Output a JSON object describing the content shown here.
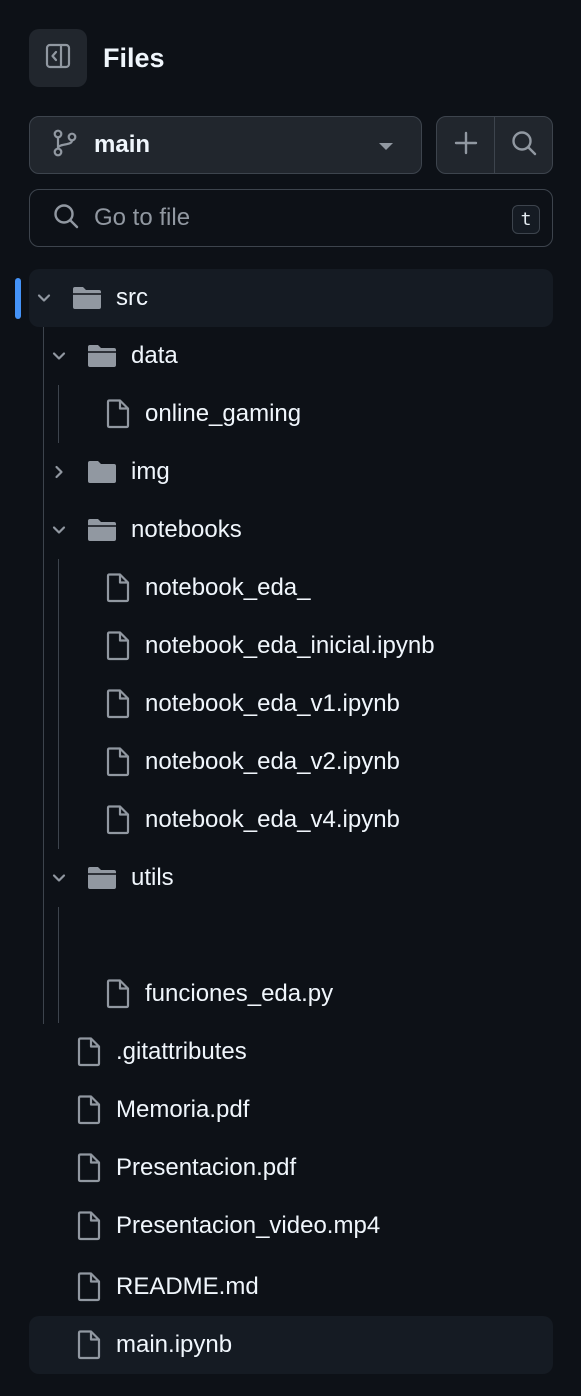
{
  "header": {
    "title": "Files",
    "collapse_icon": "sidebar-collapse-icon"
  },
  "branch": {
    "name": "main",
    "icon": "git-branch-icon"
  },
  "actions": {
    "add_icon": "plus-icon",
    "search_icon": "search-icon"
  },
  "search": {
    "placeholder": "Go to file",
    "shortcut": "t"
  },
  "colors": {
    "background": "#0d1117",
    "panel": "#21262d",
    "border": "#3d444d",
    "accent": "#4493f8",
    "text": "#f0f6fc",
    "muted": "#9198a1"
  },
  "tree": {
    "src": "src",
    "data": "data",
    "online_gaming": "online_gaming",
    "img": "img",
    "notebooks": "notebooks",
    "nb1": "notebook_eda_",
    "nb2": "notebook_eda_inicial.ipynb",
    "nb3": "notebook_eda_v1.ipynb",
    "nb4": "notebook_eda_v2.ipynb",
    "nb5": "notebook_eda_v4.ipynb",
    "utils": "utils",
    "funciones": "funciones_eda.py",
    "gitattributes": ".gitattributes",
    "memoria": "Memoria.pdf",
    "presentacion": "Presentacion.pdf",
    "presentacion_video": "Presentacion_video.mp4",
    "readme": "README.md",
    "main_nb": "main.ipynb"
  }
}
